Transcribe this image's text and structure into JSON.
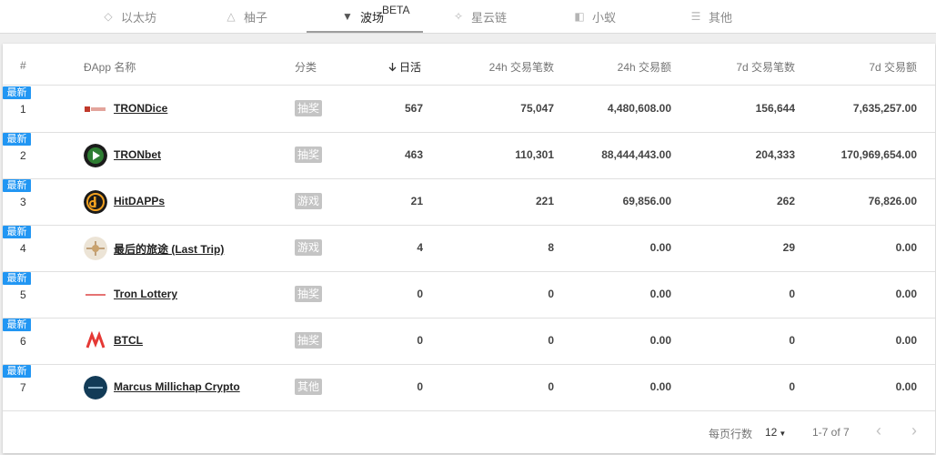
{
  "tabs": [
    {
      "label": "以太坊",
      "icon": "ethereum-icon",
      "glyph": "◇"
    },
    {
      "label": "柚子",
      "icon": "eos-icon",
      "glyph": "△"
    },
    {
      "label": "波场",
      "icon": "tron-icon",
      "glyph": "▼"
    },
    {
      "label": "星云链",
      "icon": "nebulas-icon",
      "glyph": "✧"
    },
    {
      "label": "小蚁",
      "icon": "neo-icon",
      "glyph": "◧"
    },
    {
      "label": "其他",
      "icon": "menu-icon",
      "glyph": "☰"
    }
  ],
  "active_tab_badge": "BETA",
  "table": {
    "headers": {
      "rank": "#",
      "name": "ĐApp 名称",
      "category": "分类",
      "dau": "日活",
      "tx24": "24h 交易笔数",
      "vol24": "24h 交易额",
      "tx7": "7d 交易笔数",
      "vol7": "7d 交易额"
    },
    "sort_icon": "arrow-down-icon",
    "new_badge": "最新",
    "rows": [
      {
        "rank": "1",
        "name": "TRONDice",
        "category": "抽奖",
        "dau": "567",
        "tx24": "75,047",
        "vol24": "4,480,608.00",
        "tx7": "156,644",
        "vol7": "7,635,257.00"
      },
      {
        "rank": "2",
        "name": "TRONbet",
        "category": "抽奖",
        "dau": "463",
        "tx24": "110,301",
        "vol24": "88,444,443.00",
        "tx7": "204,333",
        "vol7": "170,969,654.00"
      },
      {
        "rank": "3",
        "name": "HitDAPPs",
        "category": "游戏",
        "dau": "21",
        "tx24": "221",
        "vol24": "69,856.00",
        "tx7": "262",
        "vol7": "76,826.00"
      },
      {
        "rank": "4",
        "name": "最后的旅途 (Last Trip)",
        "category": "游戏",
        "dau": "4",
        "tx24": "8",
        "vol24": "0.00",
        "tx7": "29",
        "vol7": "0.00"
      },
      {
        "rank": "5",
        "name": "Tron Lottery",
        "category": "抽奖",
        "dau": "0",
        "tx24": "0",
        "vol24": "0.00",
        "tx7": "0",
        "vol7": "0.00"
      },
      {
        "rank": "6",
        "name": "BTCL",
        "category": "抽奖",
        "dau": "0",
        "tx24": "0",
        "vol24": "0.00",
        "tx7": "0",
        "vol7": "0.00"
      },
      {
        "rank": "7",
        "name": "Marcus Millichap Crypto",
        "category": "其他",
        "dau": "0",
        "tx24": "0",
        "vol24": "0.00",
        "tx7": "0",
        "vol7": "0.00"
      }
    ]
  },
  "footer": {
    "rows_per_page_label": "每页行数",
    "rows_per_page_value": "12",
    "range": "1-7 of 7",
    "prev": "‹",
    "next": "›"
  }
}
